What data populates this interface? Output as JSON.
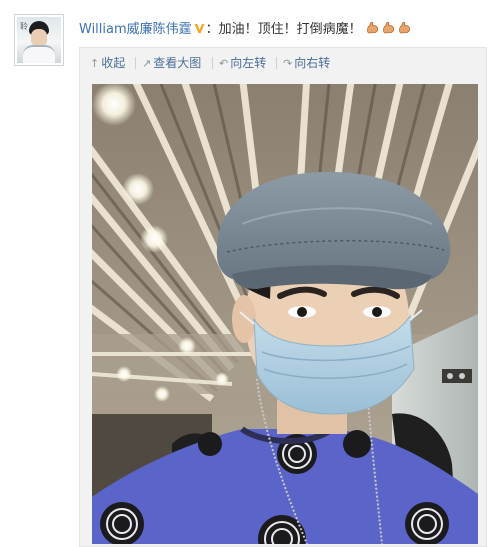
{
  "post": {
    "author": "William威廉陈伟霆",
    "text": "：加油！顶住！打倒病魔！",
    "emoji": [
      "strong-arm-emoji",
      "strong-arm-emoji",
      "strong-arm-emoji"
    ]
  },
  "avatar": {
    "char": "聆"
  },
  "toolbar": {
    "collapse_label": "收起",
    "view_large_label": "查看大图",
    "rotate_left_label": "向左转",
    "rotate_right_label": "向右转"
  },
  "colors": {
    "link": "#3b70b4",
    "verified": "#f5a623",
    "shirt": "#5b64c8",
    "mask": "#a9cbe0",
    "cap": "#7b8a96"
  }
}
